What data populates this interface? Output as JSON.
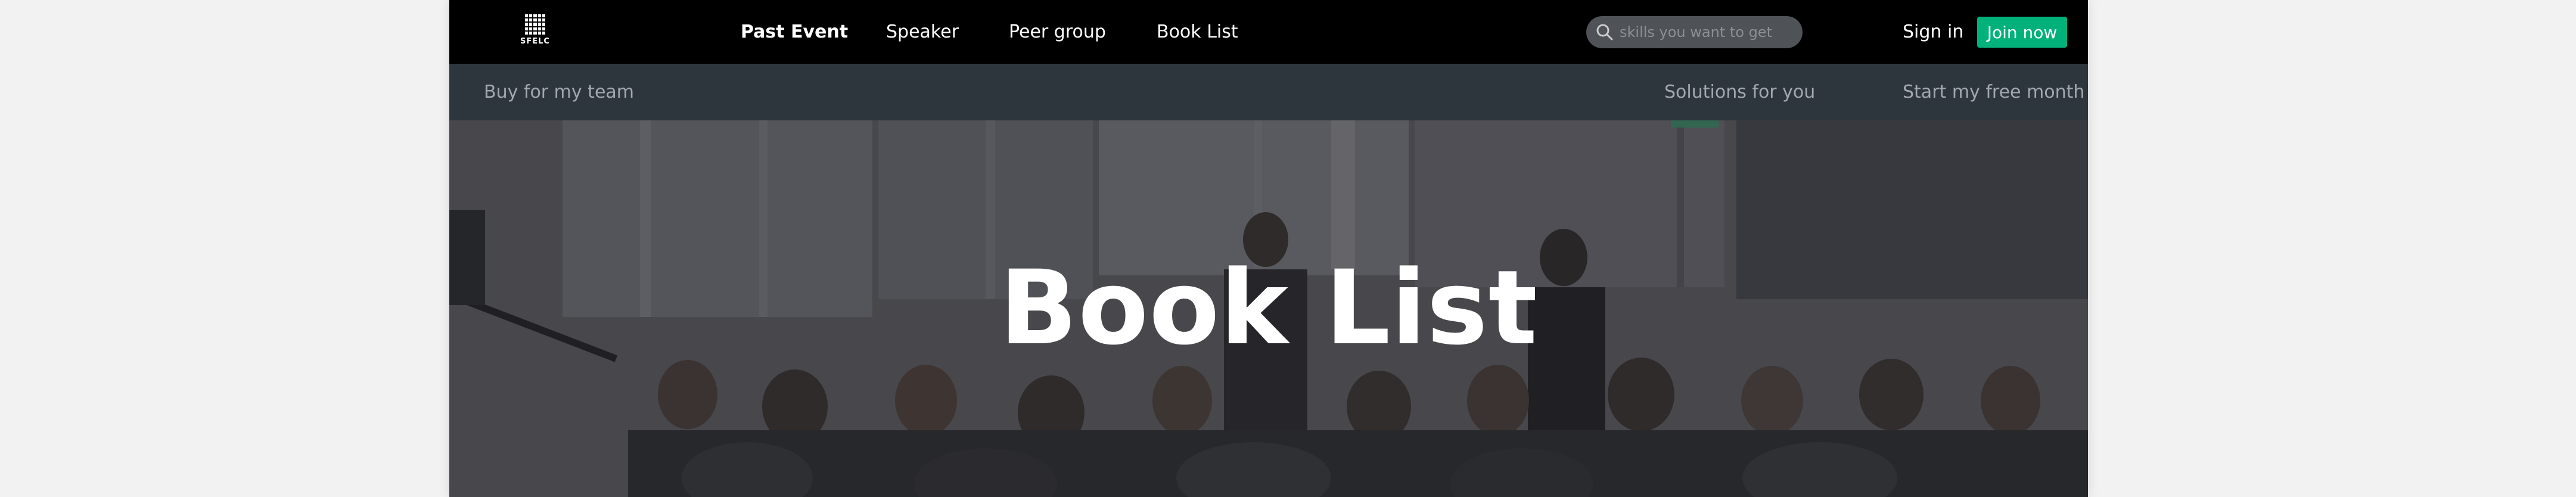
{
  "header": {
    "logo_text": "SFELC",
    "nav": [
      {
        "label": "Past Event",
        "active": true
      },
      {
        "label": "Speaker",
        "active": false
      },
      {
        "label": "Peer group",
        "active": false
      },
      {
        "label": "Book List",
        "active": false
      }
    ],
    "search": {
      "placeholder": "skills you want to get",
      "value": "",
      "icon": "search-icon"
    },
    "sign_in_label": "Sign in",
    "join_label": "Join now"
  },
  "subnav": {
    "left_label": "Buy for my team",
    "solutions_label": "Solutions for you",
    "trial_label": "Start my free month"
  },
  "hero": {
    "title": "Book List"
  },
  "colors": {
    "topbar": "#000000",
    "subbar": "#2e363d",
    "accent": "#00b279",
    "page_bg": "#f2f2f2"
  }
}
